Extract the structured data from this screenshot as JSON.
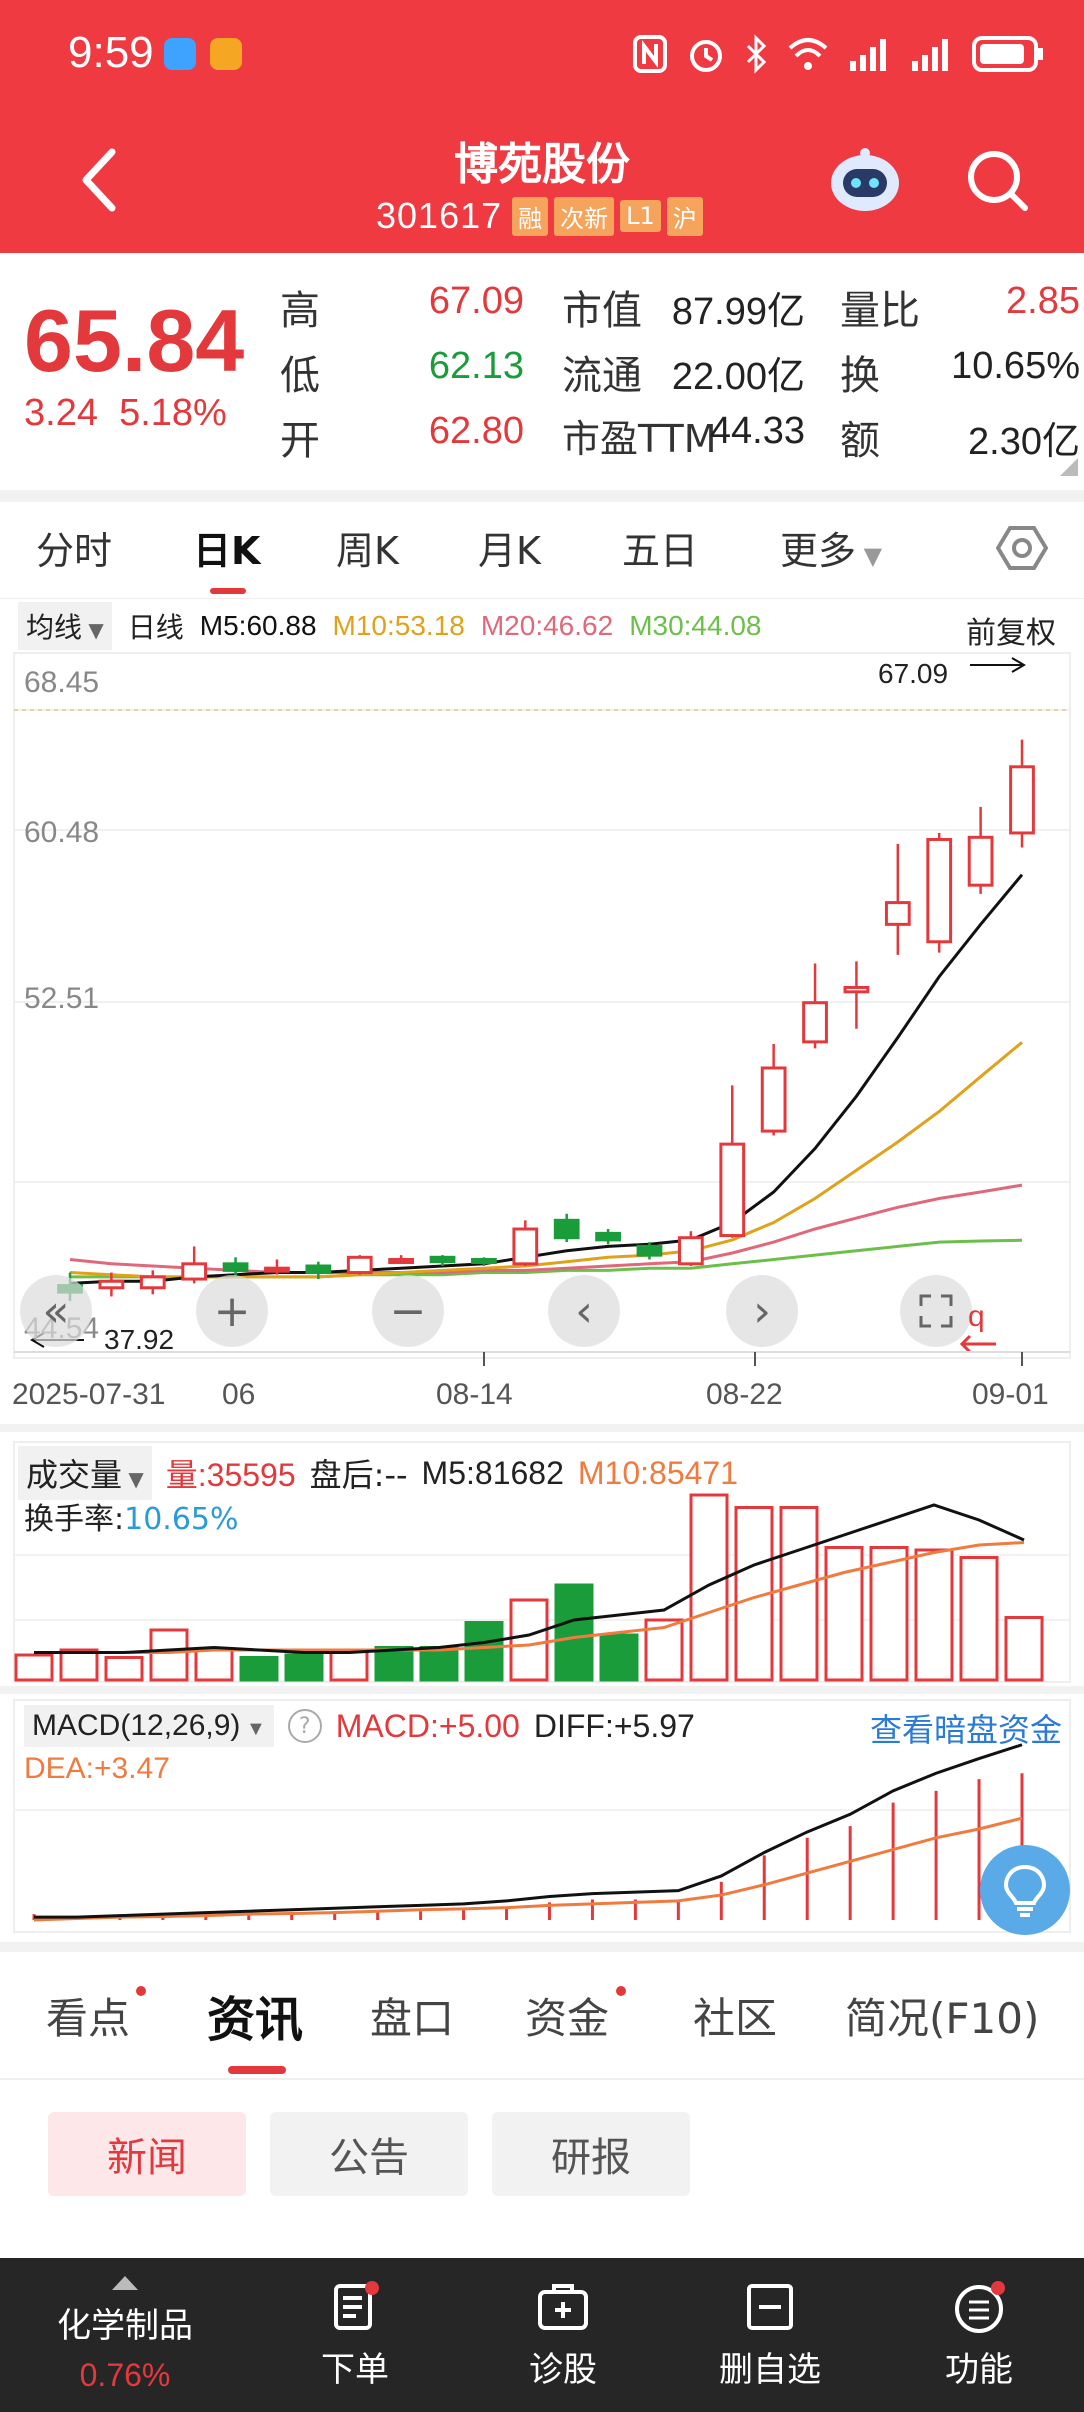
{
  "status_bar": {
    "time": "9:59"
  },
  "header": {
    "title": "博苑股份",
    "code": "301617",
    "tags": [
      "融",
      "次新",
      "L1",
      "沪"
    ]
  },
  "quote": {
    "price": "65.84",
    "change": "3.24",
    "change_pct": "5.18%",
    "rows": [
      {
        "label1": "高",
        "val1": "67.09",
        "label2": "市值",
        "val2": "87.99亿",
        "label3": "量比",
        "val3": "2.85"
      },
      {
        "label1": "低",
        "val1": "62.13",
        "label2": "流通",
        "val2": "22.00亿",
        "label3": "换",
        "val3": "10.65%"
      },
      {
        "label1": "开",
        "val1": "62.80",
        "label2": "市盈TTM",
        "val2": "44.33",
        "label3": "额",
        "val3": "2.30亿"
      }
    ]
  },
  "period_tabs": [
    "分时",
    "日K",
    "周K",
    "月K",
    "五日",
    "更多"
  ],
  "ma_bar": {
    "selector": "均线",
    "period": "日线",
    "m5": "M5:60.88",
    "m10": "M10:53.18",
    "m20": "M20:46.62",
    "m30": "M30:44.08",
    "adjust": "前复权"
  },
  "colors": {
    "red": "#e4393c",
    "green": "#1a9c3a",
    "m5": "#111111",
    "m10": "#e0a11b",
    "m20": "#e0687a",
    "m30": "#6cbf4a",
    "accent": "#ef3a42"
  },
  "chart_data": [
    {
      "type": "candlestick",
      "y_ticks": [
        "68.45",
        "60.48",
        "52.51",
        "44.54"
      ],
      "high_label": "67.09",
      "low_label": "37.92",
      "x_labels": [
        "2025-07-31",
        "06",
        "08-14",
        "08-22",
        "09-01"
      ],
      "candles": [
        {
          "o": 42.0,
          "c": 41.7,
          "h": 42.6,
          "l": 41.3
        },
        {
          "o": 41.9,
          "c": 42.2,
          "h": 42.6,
          "l": 41.5
        },
        {
          "o": 41.9,
          "c": 42.4,
          "h": 42.7,
          "l": 41.6
        },
        {
          "o": 42.3,
          "c": 43.0,
          "h": 43.8,
          "l": 42.1
        },
        {
          "o": 43.0,
          "c": 42.7,
          "h": 43.3,
          "l": 42.4
        },
        {
          "o": 42.7,
          "c": 42.8,
          "h": 43.2,
          "l": 42.5
        },
        {
          "o": 42.9,
          "c": 42.6,
          "h": 43.1,
          "l": 42.3
        },
        {
          "o": 42.6,
          "c": 43.3,
          "h": 43.4,
          "l": 42.5
        },
        {
          "o": 43.2,
          "c": 43.2,
          "h": 43.4,
          "l": 43.0
        },
        {
          "o": 43.3,
          "c": 43.1,
          "h": 43.4,
          "l": 42.9
        },
        {
          "o": 43.2,
          "c": 43.1,
          "h": 43.3,
          "l": 42.9
        },
        {
          "o": 43.0,
          "c": 44.6,
          "h": 45.0,
          "l": 42.9
        },
        {
          "o": 45.0,
          "c": 44.2,
          "h": 45.3,
          "l": 44.0
        },
        {
          "o": 44.4,
          "c": 44.1,
          "h": 44.6,
          "l": 43.9
        },
        {
          "o": 43.8,
          "c": 43.4,
          "h": 44.0,
          "l": 43.2
        },
        {
          "o": 43.0,
          "c": 44.2,
          "h": 44.5,
          "l": 42.9
        },
        {
          "o": 44.3,
          "c": 48.5,
          "h": 51.2,
          "l": 44.2
        },
        {
          "o": 49.1,
          "c": 52.0,
          "h": 53.1,
          "l": 48.9
        },
        {
          "o": 53.2,
          "c": 55.0,
          "h": 56.8,
          "l": 52.9
        },
        {
          "o": 55.5,
          "c": 55.7,
          "h": 56.9,
          "l": 53.8
        },
        {
          "o": 58.6,
          "c": 59.6,
          "h": 62.3,
          "l": 57.2
        },
        {
          "o": 57.8,
          "c": 62.5,
          "h": 62.8,
          "l": 57.3
        },
        {
          "o": 60.4,
          "c": 62.6,
          "h": 64.0,
          "l": 60.0
        },
        {
          "o": 62.8,
          "c": 65.84,
          "h": 67.09,
          "l": 62.13
        }
      ],
      "ma5": [
        42.1,
        42.2,
        42.2,
        42.4,
        42.5,
        42.6,
        42.6,
        42.7,
        42.8,
        42.9,
        43.0,
        43.3,
        43.6,
        43.8,
        43.9,
        44.1,
        44.9,
        46.3,
        48.3,
        50.7,
        53.4,
        56.2,
        58.6,
        60.88
      ],
      "ma10": [
        42.6,
        42.5,
        42.4,
        42.4,
        42.4,
        42.4,
        42.4,
        42.5,
        42.6,
        42.7,
        42.8,
        42.9,
        43.1,
        43.3,
        43.4,
        43.6,
        44.1,
        44.9,
        46.0,
        47.3,
        48.6,
        50.0,
        51.6,
        53.18
      ],
      "ma20": [
        43.2,
        43.0,
        42.9,
        42.8,
        42.7,
        42.6,
        42.6,
        42.6,
        42.6,
        42.6,
        42.7,
        42.7,
        42.8,
        42.9,
        43.0,
        43.1,
        43.5,
        44.0,
        44.6,
        45.1,
        45.6,
        46.0,
        46.3,
        46.62
      ],
      "ma30": [
        42.4,
        42.4,
        42.4,
        42.4,
        42.4,
        42.4,
        42.4,
        42.5,
        42.5,
        42.5,
        42.6,
        42.6,
        42.7,
        42.7,
        42.8,
        42.8,
        43.0,
        43.2,
        43.4,
        43.6,
        43.8,
        44.0,
        44.05,
        44.08
      ]
    },
    {
      "type": "bar",
      "title": "成交量",
      "values": [
        10,
        12,
        9,
        20,
        12,
        9,
        10,
        12,
        13,
        13,
        23,
        32,
        38,
        18,
        24,
        74,
        69,
        69,
        53,
        53,
        52,
        49,
        25
      ],
      "up": [
        true,
        true,
        true,
        true,
        true,
        false,
        false,
        true,
        false,
        false,
        false,
        true,
        false,
        false,
        true,
        true,
        true,
        true,
        true,
        true,
        true,
        true,
        true
      ],
      "ma5": [
        11,
        11,
        11,
        12,
        13,
        12,
        11,
        11,
        12,
        13,
        15,
        18,
        24,
        26,
        28,
        38,
        46,
        52,
        58,
        64,
        70,
        64,
        56
      ],
      "ma10": [
        11,
        11,
        11,
        11,
        12,
        12,
        12,
        12,
        12,
        12,
        13,
        14,
        17,
        19,
        21,
        27,
        33,
        38,
        43,
        47,
        51,
        54,
        55
      ]
    },
    {
      "type": "line",
      "title": "MACD(12,26,9)",
      "diff": [
        0.1,
        0.1,
        0.15,
        0.2,
        0.25,
        0.3,
        0.35,
        0.4,
        0.45,
        0.5,
        0.55,
        0.65,
        0.8,
        0.9,
        0.95,
        1.0,
        1.5,
        2.3,
        3.0,
        3.6,
        4.4,
        5.0,
        5.5,
        5.97
      ],
      "dea": [
        0.0,
        0.05,
        0.1,
        0.12,
        0.15,
        0.2,
        0.22,
        0.25,
        0.3,
        0.35,
        0.38,
        0.42,
        0.5,
        0.55,
        0.6,
        0.65,
        0.85,
        1.2,
        1.6,
        2.0,
        2.4,
        2.8,
        3.1,
        3.47
      ],
      "macd": [
        0.2,
        0.1,
        0.1,
        0.16,
        0.2,
        0.2,
        0.26,
        0.3,
        0.3,
        0.3,
        0.34,
        0.46,
        0.6,
        0.7,
        0.7,
        0.7,
        1.3,
        2.2,
        2.8,
        3.2,
        4.0,
        4.4,
        4.8,
        5.0
      ]
    }
  ],
  "volume": {
    "selector": "成交量",
    "vol": "量:35595",
    "after": "盘后:--",
    "m5": "M5:81682",
    "m10": "M10:85471",
    "turnover_label": "换手率:",
    "turnover_value": "10.65%"
  },
  "macd": {
    "selector": "MACD(12,26,9)",
    "help": "?",
    "macd": "MACD:+5.00",
    "diff": "DIFF:+5.97",
    "dea": "DEA:+3.47",
    "dark_pool": "查看暗盘资金"
  },
  "bottom_tabs": [
    "看点",
    "资讯",
    "盘口",
    "资金",
    "社区",
    "简况(F10)"
  ],
  "news_chips": [
    "新闻",
    "公告",
    "研报"
  ],
  "bottom_nav": {
    "sector": "化学制品",
    "sector_change": "0.76%",
    "items": [
      "下单",
      "诊股",
      "删自选",
      "功能"
    ]
  }
}
